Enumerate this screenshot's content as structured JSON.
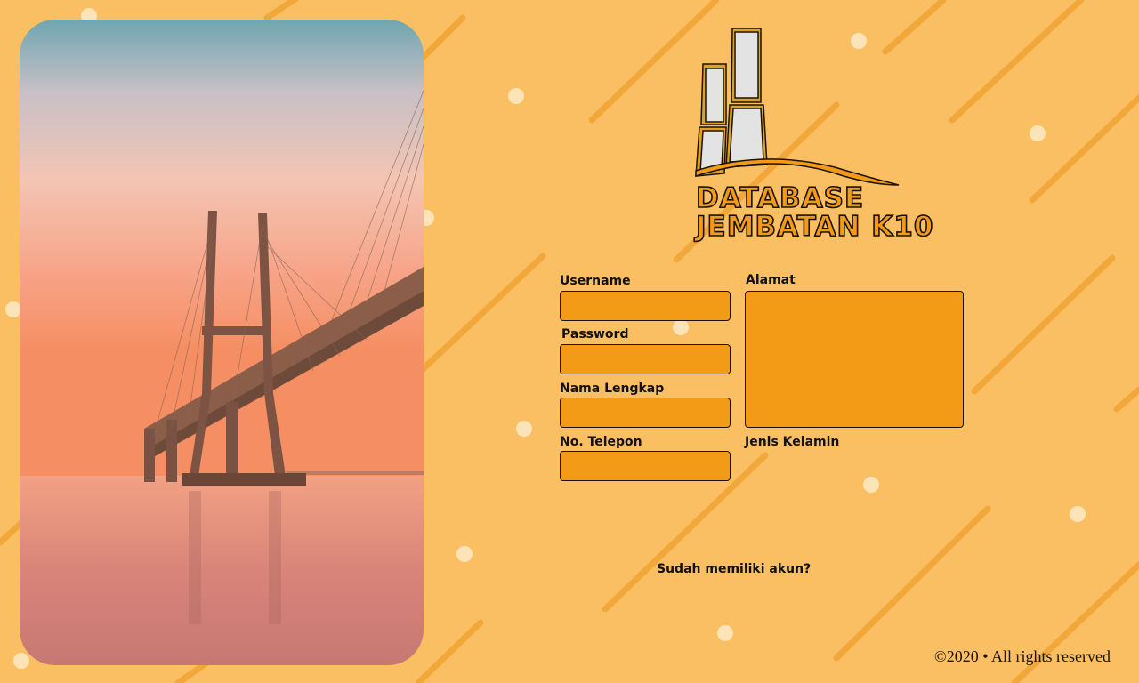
{
  "brand": {
    "line1": "DATABASE",
    "line2": "JEMBATAN K10",
    "logo_icon": "bridge-towers-icon"
  },
  "colors": {
    "background": "#fbbf63",
    "field_fill": "#f39b17",
    "text": "#111111"
  },
  "form": {
    "username_label": "Username",
    "password_label": "Password",
    "nama_label": "Nama Lengkap",
    "telepon_label": "No. Telepon",
    "alamat_label": "Alamat",
    "jenis_kelamin_label": "Jenis Kelamin",
    "username_value": "",
    "password_value": "",
    "nama_value": "",
    "telepon_value": "",
    "alamat_value": ""
  },
  "login_link": "Sudah memiliki akun?",
  "footer": "©2020 • All rights reserved"
}
